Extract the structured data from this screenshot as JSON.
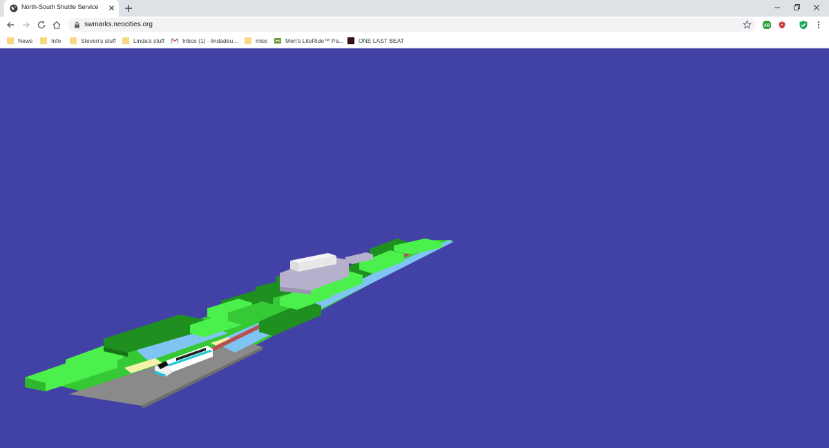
{
  "browser": {
    "tab": {
      "title": "North-South Shuttle Service",
      "favicon": "globe-icon"
    },
    "url": "swmarks.neocities.org",
    "bookmarks": [
      {
        "label": "News",
        "icon": "folder-icon"
      },
      {
        "label": "Info",
        "icon": "folder-icon"
      },
      {
        "label": "Steven's stuff",
        "icon": "folder-icon"
      },
      {
        "label": "Linda's stuff",
        "icon": "folder-icon"
      },
      {
        "label": "Inbox (1) - lindadeu...",
        "icon": "gmail-icon"
      },
      {
        "label": "misc",
        "icon": "folder-icon"
      },
      {
        "label": "Men's LiteRide™ Pa...",
        "icon": "crocs-icon"
      },
      {
        "label": "ONE LAST BEAT",
        "icon": "album-art-icon"
      }
    ],
    "extensions": [
      "adblock-icon",
      "shield-extension-icon",
      "vpn-check-icon",
      "menu-kebab-icon"
    ]
  },
  "scene": {
    "background": "#4242a6",
    "colors": {
      "grass_light": "#4cf04c",
      "grass_mid": "#36c936",
      "forest_dark": "#1f8f1f",
      "water": "#80c4f4",
      "road": "#8a8a8a",
      "sand": "#f2f2a8",
      "rock": "#b6b0cc",
      "building": "#f0f0f0",
      "track": "#b85050"
    },
    "train": {
      "body_color": "#ffffff",
      "stripe_color": "#18c8d8"
    }
  }
}
